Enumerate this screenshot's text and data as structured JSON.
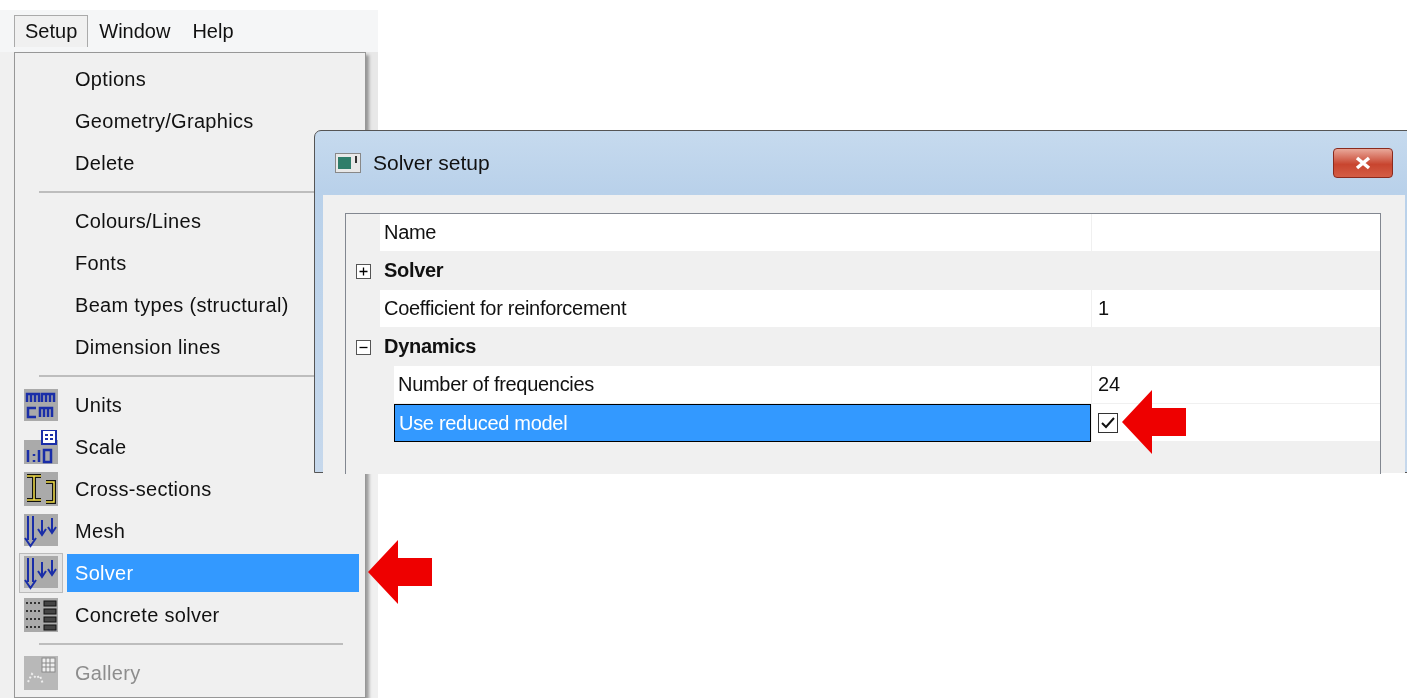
{
  "menubar": [
    {
      "label": "Setup",
      "selected": true
    },
    {
      "label": "Window",
      "selected": false
    },
    {
      "label": "Help",
      "selected": false
    }
  ],
  "menu": {
    "items": [
      {
        "kind": "item",
        "label": "Options",
        "selected": false,
        "disabled": false
      },
      {
        "kind": "item",
        "label": "Geometry/Graphics",
        "selected": false,
        "disabled": false
      },
      {
        "kind": "item",
        "label": "Delete",
        "selected": false,
        "disabled": false
      },
      {
        "kind": "separator"
      },
      {
        "kind": "item",
        "label": "Colours/Lines",
        "selected": false,
        "disabled": false
      },
      {
        "kind": "item",
        "label": "Fonts",
        "selected": false,
        "disabled": false
      },
      {
        "kind": "item",
        "label": "Beam types (structural)",
        "selected": false,
        "disabled": false
      },
      {
        "kind": "item",
        "label": "Dimension lines",
        "selected": false,
        "disabled": false
      },
      {
        "kind": "separator"
      },
      {
        "kind": "icon-item",
        "label": "Units",
        "selected": false,
        "disabled": false
      },
      {
        "kind": "icon-item",
        "label": "Scale",
        "selected": false,
        "disabled": false
      },
      {
        "kind": "icon-item",
        "label": "Cross-sections",
        "selected": false,
        "disabled": false
      },
      {
        "kind": "icon-item",
        "label": "Mesh",
        "selected": false,
        "disabled": false
      },
      {
        "kind": "icon-item",
        "label": "Solver",
        "selected": true,
        "disabled": false
      },
      {
        "kind": "icon-item",
        "label": "Concrete solver",
        "selected": false,
        "disabled": false
      },
      {
        "kind": "separator"
      },
      {
        "kind": "icon-item",
        "label": "Gallery",
        "selected": false,
        "disabled": true
      }
    ]
  },
  "dialog": {
    "title": "Solver setup",
    "properties": [
      {
        "kind": "property",
        "label": "Name",
        "selected": false
      },
      {
        "kind": "category",
        "label": "Solver",
        "expanded": false
      },
      {
        "kind": "property",
        "label": "Coefficient for reinforcement",
        "value": "1",
        "selected": false
      },
      {
        "kind": "category",
        "label": "Dynamics",
        "expanded": true,
        "children": [
          {
            "kind": "property",
            "label": "Number of frequencies",
            "value": "24",
            "selected": false
          },
          {
            "kind": "checkbox",
            "label": "Use reduced model",
            "checked": true,
            "selected": true
          }
        ]
      }
    ]
  }
}
